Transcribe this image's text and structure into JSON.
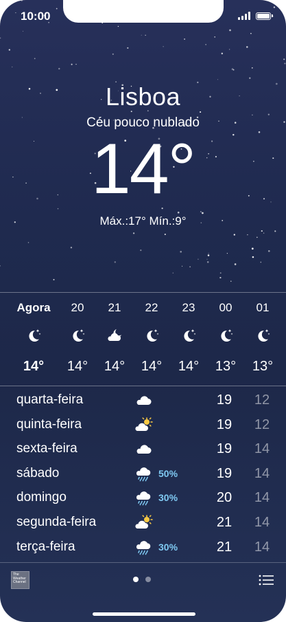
{
  "status": {
    "time": "10:00"
  },
  "location": {
    "city": "Lisboa",
    "condition": "Céu pouco nublado",
    "temperature": "14°",
    "hilo": "Máx.:17° Mín.:9°"
  },
  "hourly": [
    {
      "label": "Agora",
      "icon": "moon-stars-icon",
      "temp": "14°",
      "bold": true
    },
    {
      "label": "20",
      "icon": "moon-stars-icon",
      "temp": "14°"
    },
    {
      "label": "21",
      "icon": "cloud-moon-icon",
      "temp": "14°"
    },
    {
      "label": "22",
      "icon": "moon-stars-icon",
      "temp": "14°"
    },
    {
      "label": "23",
      "icon": "moon-stars-icon",
      "temp": "14°"
    },
    {
      "label": "00",
      "icon": "moon-stars-icon",
      "temp": "13°"
    },
    {
      "label": "01",
      "icon": "moon-stars-icon",
      "temp": "13°"
    }
  ],
  "daily": [
    {
      "day": "quarta-feira",
      "icon": "cloud-icon",
      "pct": "",
      "hi": "19",
      "lo": "12"
    },
    {
      "day": "quinta-feira",
      "icon": "cloud-sun-icon",
      "pct": "",
      "hi": "19",
      "lo": "12"
    },
    {
      "day": "sexta-feira",
      "icon": "cloud-icon",
      "pct": "",
      "hi": "19",
      "lo": "14"
    },
    {
      "day": "sábado",
      "icon": "cloud-rain-icon",
      "pct": "50%",
      "hi": "19",
      "lo": "14"
    },
    {
      "day": "domingo",
      "icon": "cloud-rain-icon",
      "pct": "30%",
      "hi": "20",
      "lo": "14"
    },
    {
      "day": "segunda-feira",
      "icon": "cloud-sun-icon",
      "pct": "",
      "hi": "21",
      "lo": "14"
    },
    {
      "day": "terça-feira",
      "icon": "cloud-rain-icon",
      "pct": "30%",
      "hi": "21",
      "lo": "14"
    }
  ],
  "footer": {
    "logo_text": "The Weather Channel",
    "pages": 2,
    "active_page": 0
  },
  "colors": {
    "precip": "#7fc9f2",
    "sun": "#f7c844"
  }
}
